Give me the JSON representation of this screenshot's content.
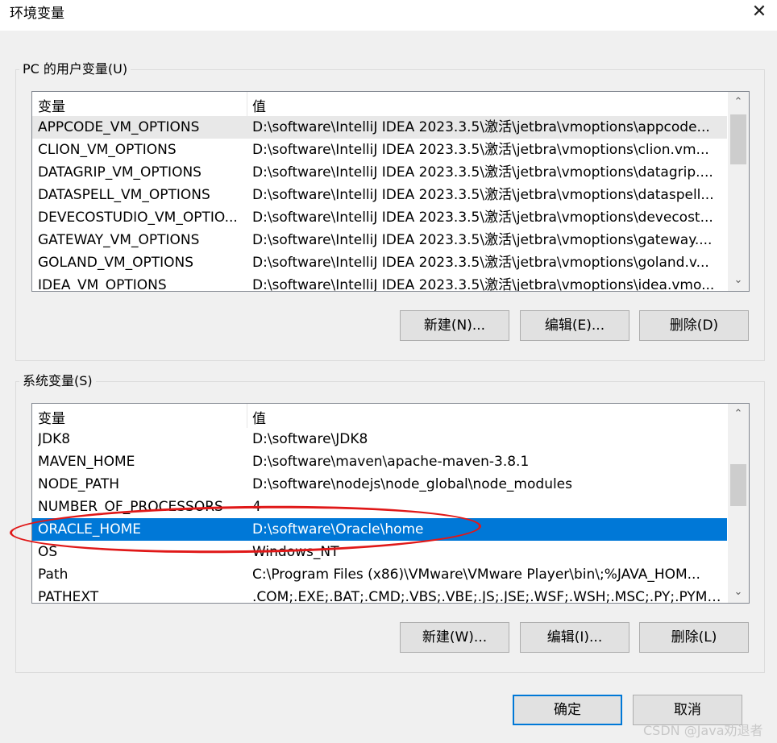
{
  "window": {
    "title": "环境变量",
    "close_glyph": "✕"
  },
  "user_section": {
    "legend": "PC 的用户变量(U)",
    "columns": {
      "name": "变量",
      "value": "值"
    },
    "rows": [
      {
        "name": "APPCODE_VM_OPTIONS",
        "value": "D:\\software\\IntelliJ IDEA 2023.3.5\\激活\\jetbra\\vmoptions\\appcode..."
      },
      {
        "name": "CLION_VM_OPTIONS",
        "value": "D:\\software\\IntelliJ IDEA 2023.3.5\\激活\\jetbra\\vmoptions\\clion.vm..."
      },
      {
        "name": "DATAGRIP_VM_OPTIONS",
        "value": "D:\\software\\IntelliJ IDEA 2023.3.5\\激活\\jetbra\\vmoptions\\datagrip...."
      },
      {
        "name": "DATASPELL_VM_OPTIONS",
        "value": "D:\\software\\IntelliJ IDEA 2023.3.5\\激活\\jetbra\\vmoptions\\dataspell..."
      },
      {
        "name": "DEVECOSTUDIO_VM_OPTIO...",
        "value": "D:\\software\\IntelliJ IDEA 2023.3.5\\激活\\jetbra\\vmoptions\\devecost..."
      },
      {
        "name": "GATEWAY_VM_OPTIONS",
        "value": "D:\\software\\IntelliJ IDEA 2023.3.5\\激活\\jetbra\\vmoptions\\gateway...."
      },
      {
        "name": "GOLAND_VM_OPTIONS",
        "value": "D:\\software\\IntelliJ IDEA 2023.3.5\\激活\\jetbra\\vmoptions\\goland.v..."
      },
      {
        "name": "IDEA_VM_OPTIONS",
        "value": "D:\\software\\IntelliJ IDEA 2023.3.5\\激活\\jetbra\\vmoptions\\idea.vmo..."
      }
    ],
    "buttons": {
      "new": "新建(N)...",
      "edit": "编辑(E)...",
      "delete": "删除(D)"
    }
  },
  "system_section": {
    "legend": "系统变量(S)",
    "columns": {
      "name": "变量",
      "value": "值"
    },
    "rows": [
      {
        "name": "JDK8",
        "value": "D:\\software\\JDK8"
      },
      {
        "name": "MAVEN_HOME",
        "value": "D:\\software\\maven\\apache-maven-3.8.1"
      },
      {
        "name": "NODE_PATH",
        "value": "D:\\software\\nodejs\\node_global\\node_modules"
      },
      {
        "name": "NUMBER_OF_PROCESSORS",
        "value": "4"
      },
      {
        "name": "ORACLE_HOME",
        "value": "D:\\software\\Oracle\\home"
      },
      {
        "name": "OS",
        "value": "Windows_NT"
      },
      {
        "name": "Path",
        "value": "C:\\Program Files (x86)\\VMware\\VMware Player\\bin\\;%JAVA_HOM..."
      },
      {
        "name": "PATHEXT",
        "value": ".COM;.EXE;.BAT;.CMD;.VBS;.VBE;.JS;.JSE;.WSF;.WSH;.MSC;.PY;.PYM;.M"
      }
    ],
    "buttons": {
      "new": "新建(W)...",
      "edit": "编辑(I)...",
      "delete": "删除(L)"
    }
  },
  "footer": {
    "ok": "确定",
    "cancel": "取消"
  },
  "watermark": "CSDN @Java劝退者",
  "colors": {
    "selection": "#0078d7",
    "annotation": "#e01818"
  }
}
